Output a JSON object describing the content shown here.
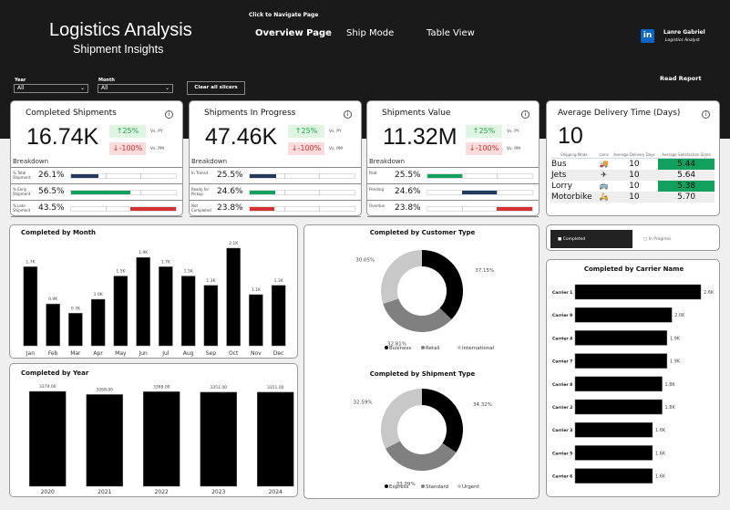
{
  "header": {
    "title": "Logistics Analysis",
    "subtitle": "Shipment Insights",
    "nav_hint": "Click to Navigate Page",
    "nav": [
      "Overview Page",
      "Ship Mode",
      "Table View"
    ],
    "user_name": "Lanre Gabriel",
    "user_role": "Logistics Analyst",
    "linkedin_icon": "in",
    "read_report": "Read Report"
  },
  "slicers": {
    "year_label": "Year",
    "year_value": "All",
    "month_label": "Month",
    "month_value": "All",
    "clear": "Clear all slicers"
  },
  "kpis": [
    {
      "title": "Completed Shipments",
      "value": "16.74K",
      "vs_py": "↑25%",
      "vs_py_label": "Vs. PY",
      "vs_pm": "↓-100%",
      "vs_pm_label": "Vs. PM",
      "breakdown": "Breakdown",
      "rows": [
        {
          "label": "% Total Shipment",
          "value": "26.1%",
          "pct": 26.1
        },
        {
          "label": "% Early Shipment",
          "value": "56.5%",
          "pct": 56.5
        },
        {
          "label": "% Late Shipment",
          "value": "43.5%",
          "pct": 43.5
        }
      ]
    },
    {
      "title": "Shipments In Progress",
      "value": "47.46K",
      "vs_py": "↑25%",
      "vs_py_label": "Vs. PY",
      "vs_pm": "↓-100%",
      "vs_pm_label": "Vs. PM",
      "breakdown": "Breakdown",
      "rows": [
        {
          "label": "In Transit",
          "value": "25.5%",
          "pct": 25.5
        },
        {
          "label": "Ready for Pickup",
          "value": "24.6%",
          "pct": 24.6
        },
        {
          "label": "Not Completed",
          "value": "23.8%",
          "pct": 23.8
        }
      ]
    },
    {
      "title": "Shipments Value",
      "value": "11.32M",
      "vs_py": "↑25%",
      "vs_py_label": "Vs. PY",
      "vs_pm": "↓-100%",
      "vs_pm_label": "Vs. PM",
      "breakdown": "Breakdown",
      "rows": [
        {
          "label": "Paid",
          "value": "25.5%",
          "pct": 25.5
        },
        {
          "label": "Pending",
          "value": "24.6%",
          "pct": 24.6
        },
        {
          "label": "Overdue",
          "value": "23.8%",
          "pct": 23.8
        }
      ]
    }
  ],
  "delivery": {
    "title": "Average Delivery Time (Days)",
    "value": "10",
    "columns": [
      "Shipping Mode",
      "Icons",
      "Average Delivery Days",
      "Average Satisfaction Score"
    ],
    "rows": [
      {
        "mode": "Bus",
        "icon": "🚚",
        "days": "10",
        "score": "5.44"
      },
      {
        "mode": "Jets",
        "icon": "✈",
        "days": "10",
        "score": "5.64"
      },
      {
        "mode": "Lorry",
        "icon": "🚌",
        "days": "10",
        "score": "5.38"
      },
      {
        "mode": "Motorbike",
        "icon": "🛵",
        "days": "10",
        "score": "5.70"
      }
    ]
  },
  "toggle": {
    "active": "Completed",
    "inactive": "In Progress"
  },
  "colors": {
    "green": "#12a15c",
    "navy": "#223a5e",
    "red": "#d63232",
    "dark": "#1a1a1a"
  },
  "chart_data": [
    {
      "type": "bar",
      "title": "Completed by Month",
      "categories": [
        "Jan",
        "Feb",
        "Mar",
        "Apr",
        "May",
        "Jun",
        "Jul",
        "Aug",
        "Sep",
        "Oct",
        "Nov",
        "Dec"
      ],
      "values": [
        1.7,
        0.9,
        0.7,
        1.0,
        1.5,
        1.9,
        1.7,
        1.5,
        1.3,
        2.1,
        1.1,
        1.3
      ],
      "labels": [
        "1.7K",
        "0.9K",
        "0.7K",
        "1.0K",
        "1.5K",
        "1.9K",
        "1.7K",
        "1.5K",
        "1.3K",
        "2.1K",
        "1.1K",
        "1.3K"
      ]
    },
    {
      "type": "bar",
      "title": "Completed by Year",
      "categories": [
        "2020",
        "2021",
        "2022",
        "2023",
        "2024"
      ],
      "values": [
        3379,
        3268,
        3368,
        3351,
        3351
      ],
      "labels": [
        "3379.00",
        "3268.00",
        "3368.00",
        "3351.00",
        "3351.00"
      ]
    },
    {
      "type": "pie",
      "title": "Completed by Customer Type",
      "categories": [
        "Business",
        "Retail",
        "International"
      ],
      "values": [
        37.15,
        32.81,
        30.05
      ],
      "labels": [
        "37.15%",
        "32.81%",
        "30.05%"
      ],
      "colors": [
        "#000000",
        "#808080",
        "#c8c8c8"
      ]
    },
    {
      "type": "pie",
      "title": "Completed by Shipment Type",
      "categories": [
        "Express",
        "Standard",
        "Urgent"
      ],
      "values": [
        34.32,
        33.09,
        32.59
      ],
      "labels": [
        "34.32%",
        "33.09%",
        "32.59%"
      ],
      "colors": [
        "#000000",
        "#808080",
        "#c8c8c8"
      ]
    },
    {
      "type": "bar",
      "orientation": "horizontal",
      "title": "Completed by Carrier Name",
      "categories": [
        "Carrier 1",
        "Carrier 9",
        "Carrier 4",
        "Carrier 7",
        "Carrier 8",
        "Carrier 2",
        "Carrier 3",
        "Carrier 5",
        "Carrier 6"
      ],
      "values": [
        2.6,
        2.0,
        1.9,
        1.9,
        1.8,
        1.8,
        1.6,
        1.6,
        1.6
      ],
      "labels": [
        "2.6K",
        "2.0K",
        "1.9K",
        "1.9K",
        "1.8K",
        "1.8K",
        "1.6K",
        "1.6K",
        "1.6K"
      ]
    }
  ]
}
